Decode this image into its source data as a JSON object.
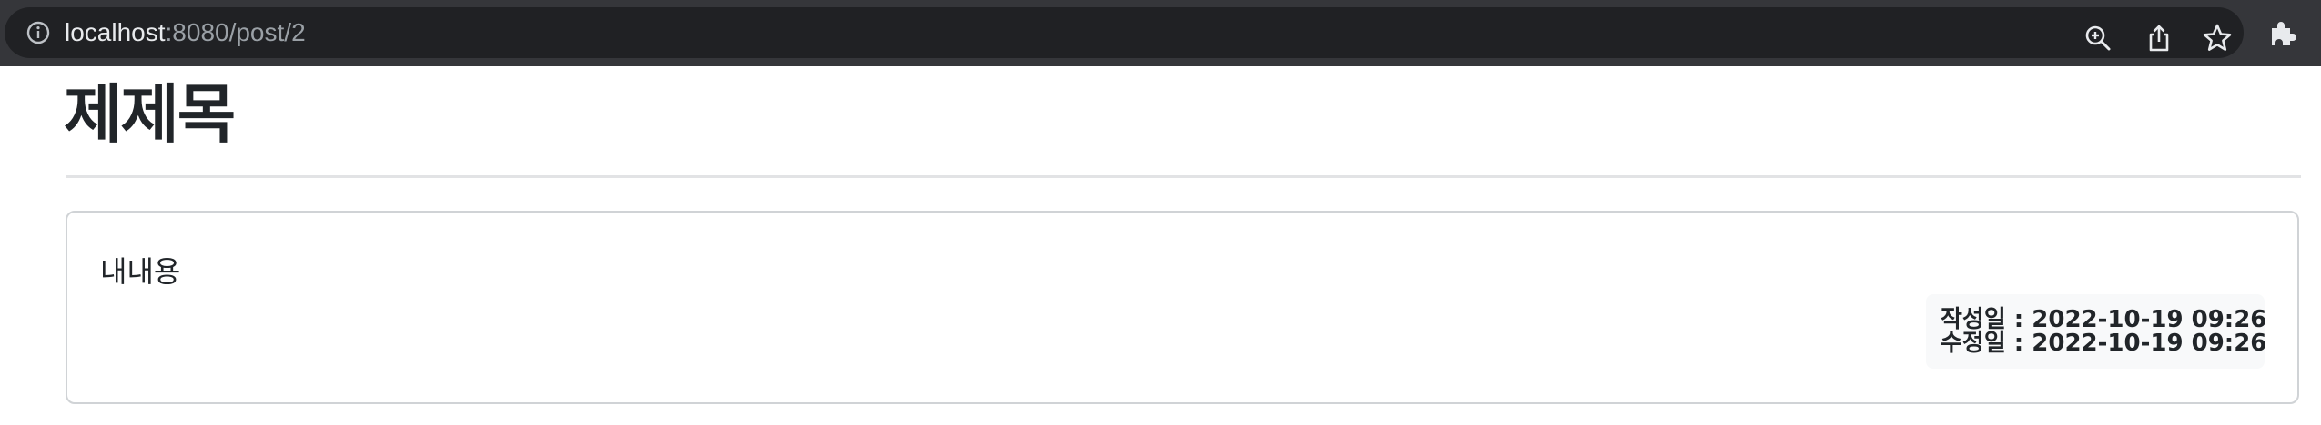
{
  "browser": {
    "url_host": "localhost",
    "url_rest": ":8080/post/2",
    "icons": [
      "info-icon",
      "zoom-icon",
      "share-icon",
      "bookmark-star-icon",
      "extensions-puzzle-icon"
    ]
  },
  "post": {
    "title": "제제목",
    "content": "내내용",
    "created": "작성일 : 2022-10-19 09:26",
    "modified": "수정일 : 2022-10-19 09:26"
  }
}
